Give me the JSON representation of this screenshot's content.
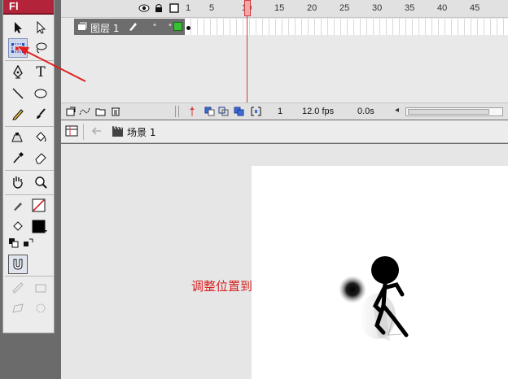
{
  "app": {
    "logo_text": "Fl"
  },
  "toolbar": {
    "tools": [
      {
        "name": "selection-tool",
        "icon": "arrow-icon"
      },
      {
        "name": "subselection-tool",
        "icon": "subselect-icon"
      },
      {
        "name": "free-transform-tool",
        "icon": "free-transform-icon",
        "selected": true
      },
      {
        "name": "lasso-tool",
        "icon": "lasso-icon"
      },
      {
        "name": "pen-tool",
        "icon": "pen-icon"
      },
      {
        "name": "text-tool",
        "icon": "text-icon",
        "glyph": "T"
      },
      {
        "name": "line-tool",
        "icon": "line-icon"
      },
      {
        "name": "oval-tool",
        "icon": "oval-icon"
      },
      {
        "name": "pencil-tool",
        "icon": "pencil-icon"
      },
      {
        "name": "brush-tool",
        "icon": "brush-icon"
      },
      {
        "name": "ink-bottle-tool",
        "icon": "ink-bottle-icon"
      },
      {
        "name": "paint-bucket-tool",
        "icon": "paint-bucket-icon"
      },
      {
        "name": "eyedropper-tool",
        "icon": "eyedropper-icon"
      },
      {
        "name": "eraser-tool",
        "icon": "eraser-icon"
      },
      {
        "name": "hand-tool",
        "icon": "hand-icon"
      },
      {
        "name": "zoom-tool",
        "icon": "zoom-icon"
      }
    ],
    "stroke_color": "#000000",
    "fill_color": "#000000"
  },
  "timeline": {
    "frame_numbers": [
      "1",
      "5",
      "10",
      "15",
      "20",
      "25",
      "30",
      "35",
      "40",
      "45"
    ],
    "layer": {
      "name": "图层 1"
    },
    "status": {
      "current_frame": "1",
      "frame_rate": "12.0 fps",
      "elapsed": "0.0s"
    }
  },
  "editbar": {
    "scene_name": "场景 1"
  },
  "stage": {
    "annotation": "调整位置到差不多有效果"
  },
  "colors": {
    "accent_red": "#d82020",
    "playhead": "#d23a3a",
    "keyframe_green": "#35c235"
  }
}
